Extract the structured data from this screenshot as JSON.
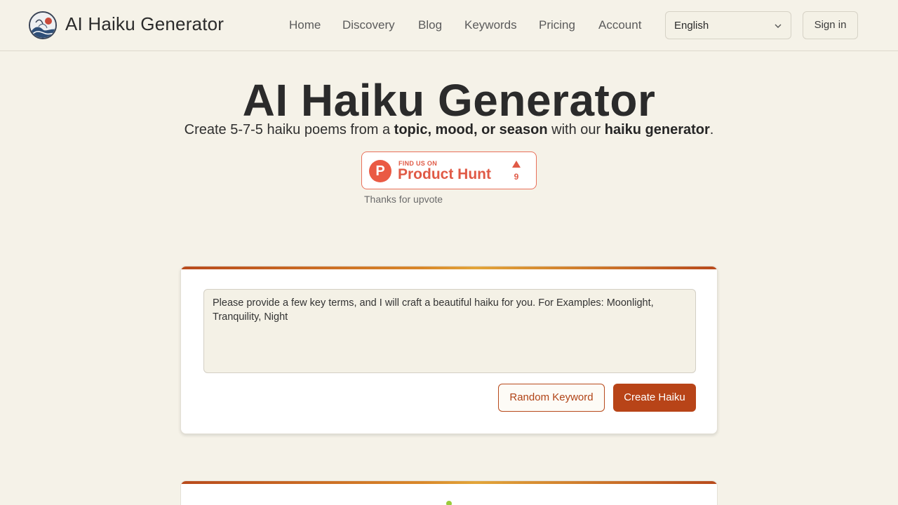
{
  "header": {
    "brand": "AI Haiku Generator",
    "nav": [
      "Home",
      "Discovery",
      "Blog",
      "Keywords",
      "Pricing",
      "Account"
    ],
    "language": "English",
    "signin": "Sign in"
  },
  "hero": {
    "title": "AI Haiku Generator",
    "subtitle_parts": [
      {
        "text": "Create 5-7-5 haiku poems from a ",
        "bold": false
      },
      {
        "text": "topic, mood, or season",
        "bold": true
      },
      {
        "text": " with our ",
        "bold": false
      },
      {
        "text": "haiku generator",
        "bold": true
      },
      {
        "text": ".",
        "bold": false
      }
    ],
    "badge": {
      "small": "FIND US ON",
      "big": "Product Hunt",
      "logo_letter": "P",
      "count": "9"
    },
    "thanks": "Thanks for upvote"
  },
  "form": {
    "placeholder": "Please provide a few key terms, and I will craft a beautiful haiku for you. For Examples: Moonlight, Tranquility, Night",
    "random_label": "Random Keyword",
    "create_label": "Create Haiku"
  },
  "colors": {
    "accent": "#b84418",
    "background": "#f5f2e8",
    "producthunt": "#ea5a44"
  }
}
